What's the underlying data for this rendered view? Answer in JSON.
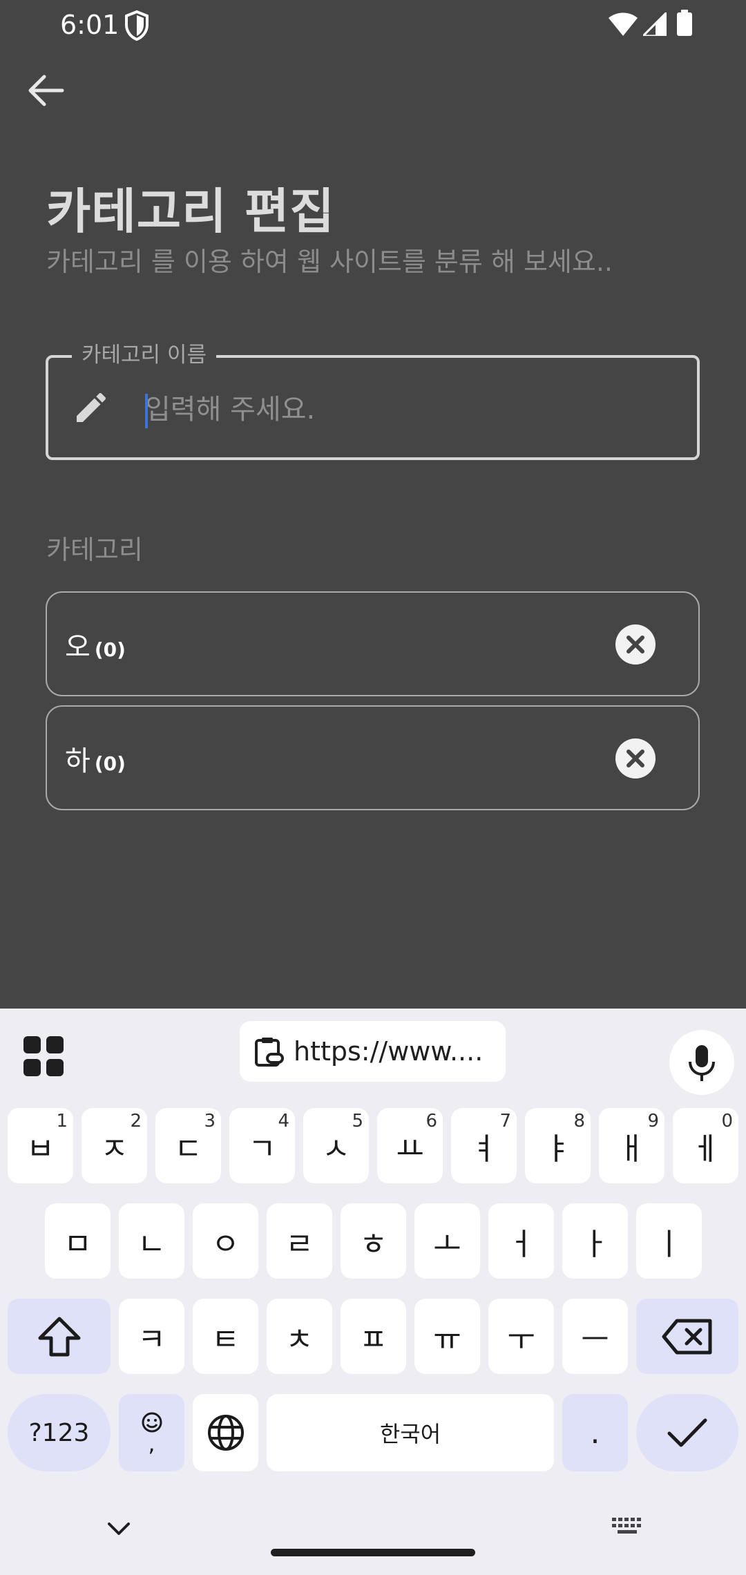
{
  "status_bar": {
    "time": "6:01"
  },
  "header": {
    "title": "카테고리 편집",
    "subtitle": "카테고리 를 이용 하여 웹 사이트를 분류 해 보세요.."
  },
  "name_field": {
    "label": "카테고리 이름",
    "placeholder": "입력해 주세요.",
    "value": ""
  },
  "categories": {
    "label": "카테고리",
    "items": [
      {
        "name": "오",
        "count": "(0)"
      },
      {
        "name": "하",
        "count": "(0)"
      }
    ]
  },
  "keyboard": {
    "clipboard_text": "https://www....",
    "row1": [
      {
        "key": "ㅂ",
        "hint": "1"
      },
      {
        "key": "ㅈ",
        "hint": "2"
      },
      {
        "key": "ㄷ",
        "hint": "3"
      },
      {
        "key": "ㄱ",
        "hint": "4"
      },
      {
        "key": "ㅅ",
        "hint": "5"
      },
      {
        "key": "ㅛ",
        "hint": "6"
      },
      {
        "key": "ㅕ",
        "hint": "7"
      },
      {
        "key": "ㅑ",
        "hint": "8"
      },
      {
        "key": "ㅐ",
        "hint": "9"
      },
      {
        "key": "ㅔ",
        "hint": "0"
      }
    ],
    "row2": [
      "ㅁ",
      "ㄴ",
      "ㅇ",
      "ㄹ",
      "ㅎ",
      "ㅗ",
      "ㅓ",
      "ㅏ",
      "ㅣ"
    ],
    "row3": [
      "ㅋ",
      "ㅌ",
      "ㅊ",
      "ㅍ",
      "ㅠ",
      "ㅜ",
      "ㅡ"
    ],
    "symbols_label": "?123",
    "emoji_comma": ",",
    "space_label": "한국어",
    "period_label": ".",
    "colors": {
      "function_key": "#dfe1f8",
      "key": "#ffffff",
      "background": "#eeedf3"
    }
  },
  "colors": {
    "app_background": "#454545",
    "caret": "#3d74d8"
  }
}
